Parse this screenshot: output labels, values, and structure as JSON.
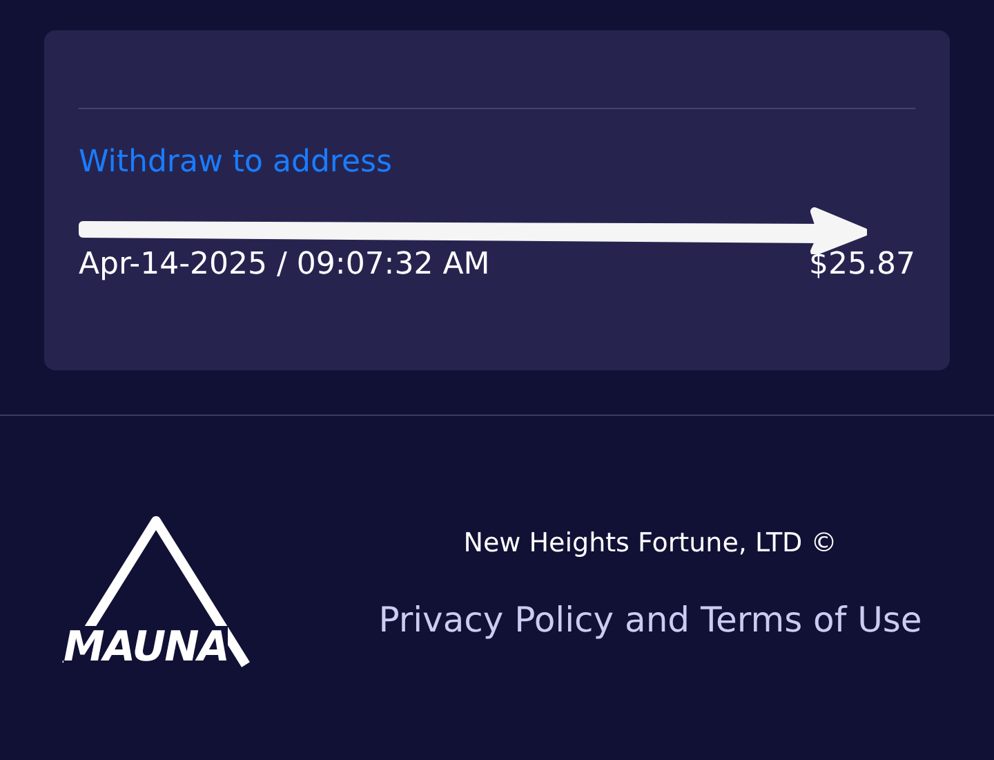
{
  "transaction": {
    "type": "Withdraw to address",
    "datetime": "Apr-14-2025 / 09:07:32 AM",
    "amount": "$25.87"
  },
  "footer": {
    "logo": "MAUNA",
    "company": "New Heights Fortune, LTD ©",
    "legal_link": "Privacy Policy and Terms of Use"
  }
}
